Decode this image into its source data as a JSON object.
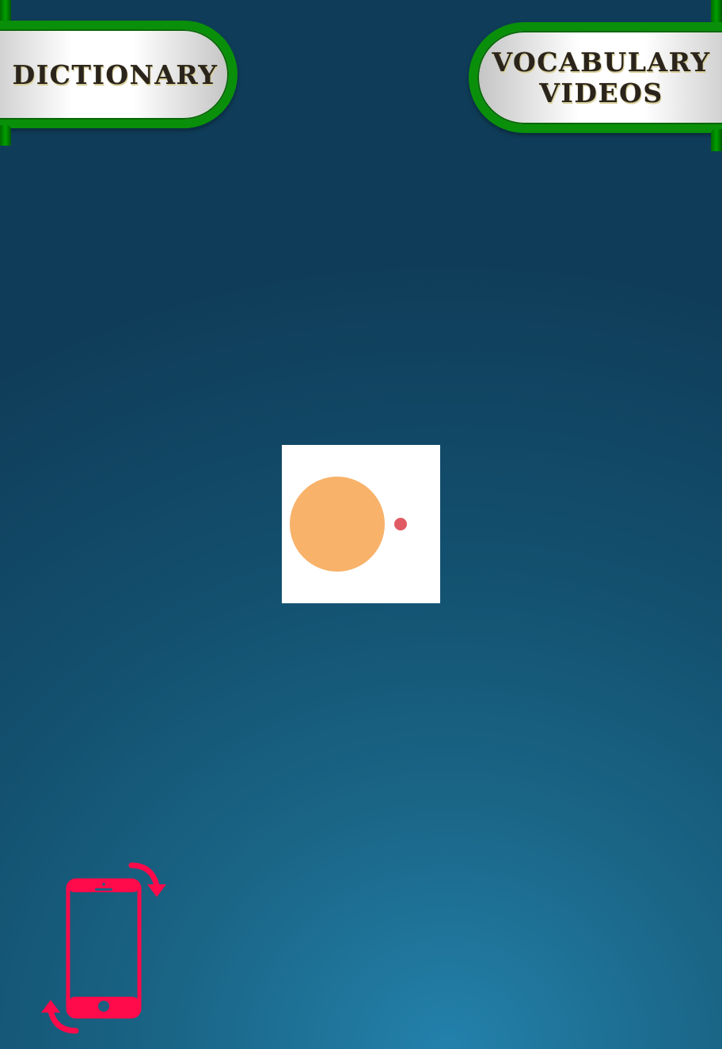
{
  "top_left_button": {
    "label": "DICTIONARY"
  },
  "top_right_button": {
    "label_line1": "VOCABULARY",
    "label_line2": "VIDEOS"
  },
  "loader": {
    "icon": "loading-dots",
    "colors": {
      "background": "#ffffff",
      "large_dot": "#f8b26a",
      "small_dot": "#e15b64"
    }
  },
  "rotate_hint": {
    "icon": "rotate-device-icon",
    "color": "#ff0a4a"
  },
  "theme": {
    "background_gradient": [
      "#2381ab",
      "#13506f",
      "#0f3d59"
    ],
    "ribbon_green": "#0a8f0a",
    "label_color": "#2a241c"
  }
}
